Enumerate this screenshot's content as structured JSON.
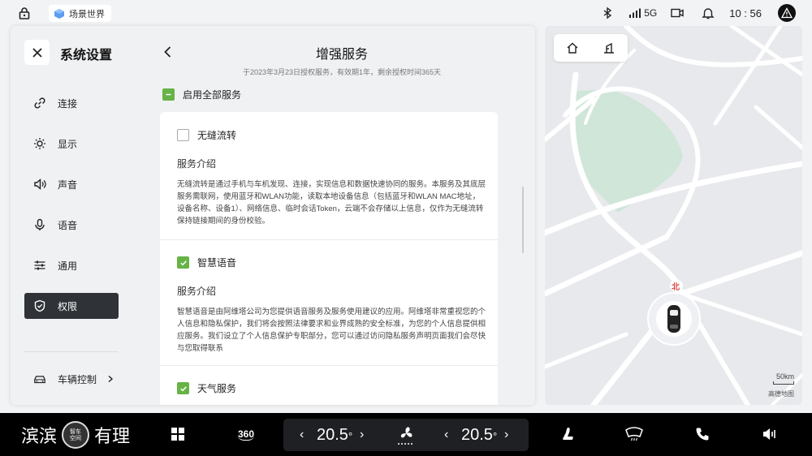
{
  "status": {
    "scene_label": "场景世界",
    "network": "5G",
    "time": "10 : 56"
  },
  "settings": {
    "title": "系统设置",
    "nav": [
      {
        "label": "连接",
        "icon": "link-icon"
      },
      {
        "label": "显示",
        "icon": "sun-icon"
      },
      {
        "label": "声音",
        "icon": "speaker-icon"
      },
      {
        "label": "语音",
        "icon": "microphone-icon"
      },
      {
        "label": "通用",
        "icon": "sliders-icon"
      },
      {
        "label": "权限",
        "icon": "shield-icon",
        "active": true
      }
    ],
    "vehicle_control": "车辆控制"
  },
  "main": {
    "title": "增强服务",
    "subtitle": "于2023年3月23日授权服务，有效期1年，剩余授权时间365天",
    "enable_all": "启用全部服务",
    "services": [
      {
        "name": "无缝流转",
        "checked": false,
        "intro_label": "服务介绍",
        "desc": "无缝流转是通过手机与车机发现、连接，实现信息和数据快速协同的服务。本服务及其底层服务需联网，使用蓝牙和WLAN功能，读取本地设备信息（包括蓝牙和WLAN MAC地址，设备名称、设备1）、网络信息、临时会话Token，云端不会存储以上信息，仅作为无缝流转保持链接期间的身份校验。"
      },
      {
        "name": "智慧语音",
        "checked": true,
        "intro_label": "服务介绍",
        "desc": "智慧语音是由阿维塔公司为您提供语音服务及服务使用建议的应用。阿维塔非常重视您的个人信息和隐私保护，我们将会按照法律要求和业界成熟的安全标准，为您的个人信息提供相应服务。我们设立了个人信息保护专职部分，您可以通过访问隐私服务声明页面我们会尽快与您取得联系"
      },
      {
        "name": "天气服务",
        "checked": true
      }
    ]
  },
  "map": {
    "north": "北",
    "scale": "50km",
    "brand": "高德地图"
  },
  "dock": {
    "view360": "360",
    "left_temp": "20.5",
    "right_temp": "20.5",
    "degree": "°",
    "watermark_left": "滨滨",
    "watermark_right": "有理",
    "badge_text": "智车\n空间"
  },
  "colors": {
    "accent_green": "#67b347",
    "nav_active": "#2f3237",
    "map_green": "#cfe6d8"
  }
}
